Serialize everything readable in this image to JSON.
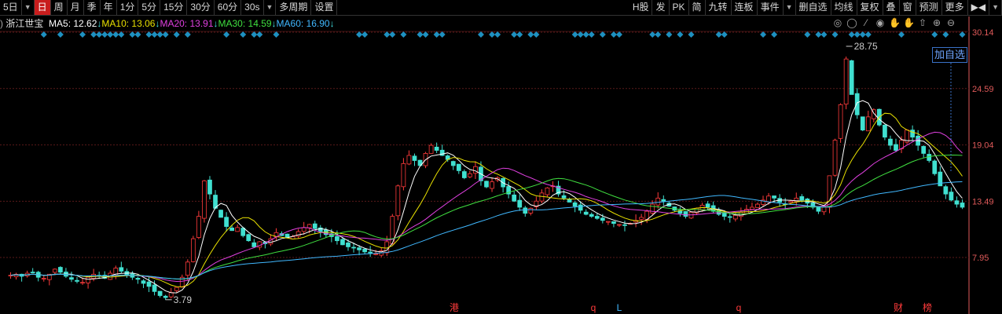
{
  "toolbar": {
    "left": [
      {
        "label": "5日",
        "active": false,
        "caret": true
      },
      {
        "label": "日",
        "active": true
      },
      {
        "label": "周"
      },
      {
        "label": "月"
      },
      {
        "label": "季"
      },
      {
        "label": "年"
      },
      {
        "label": "1分"
      },
      {
        "label": "5分"
      },
      {
        "label": "15分"
      },
      {
        "label": "30分"
      },
      {
        "label": "60分"
      },
      {
        "label": "30s",
        "caret": true
      },
      {
        "label": "多周期"
      },
      {
        "label": "设置"
      }
    ],
    "right": [
      {
        "label": "H股"
      },
      {
        "label": "发"
      },
      {
        "label": "PK"
      },
      {
        "label": "简"
      },
      {
        "label": "九转"
      },
      {
        "label": "连板"
      },
      {
        "label": "事件",
        "caret": true
      },
      {
        "label": "删自选"
      },
      {
        "label": "均线"
      },
      {
        "label": "复权"
      },
      {
        "label": "叠"
      },
      {
        "label": "窗"
      },
      {
        "label": "预测"
      },
      {
        "label": "更多"
      },
      {
        "label": "▶◀",
        "caret": true
      }
    ]
  },
  "ma_line": {
    "stock_name": "浙江世宝",
    "items": [
      {
        "label": "MA5: 12.62",
        "arrow": "↓",
        "color": "#ffffff"
      },
      {
        "label": "MA10: 13.06",
        "arrow": "↓",
        "color": "#e8e000"
      },
      {
        "label": "MA20: 13.91",
        "arrow": "↓",
        "color": "#e040e0"
      },
      {
        "label": "MA30: 14.59",
        "arrow": "↓",
        "color": "#40e040"
      },
      {
        "label": "MA60: 16.90",
        "arrow": "↓",
        "color": "#40b8ff"
      }
    ]
  },
  "tool_icons": [
    "target-icon",
    "circle-icon",
    "brush-icon",
    "eye-icon",
    "hand-icon",
    "hand-icon",
    "up-arrow-icon",
    "zoom-in-icon",
    "zoom-out-icon"
  ],
  "add_favorite": "加自选",
  "colors": {
    "up": "#ff3b3b",
    "down": "#40e0d0",
    "grid": "#5a1a1a",
    "axis": "#e05a5a",
    "marker": "#1e90c0"
  },
  "chart_data": {
    "type": "candlestick",
    "stock": "浙江世宝",
    "y_ticks": [
      30.14,
      24.59,
      19.04,
      13.49,
      7.95
    ],
    "ylim": [
      3.5,
      30.5
    ],
    "annotations": [
      {
        "text": "28.75",
        "label": "high",
        "value": 28.75
      },
      {
        "text": "3.79",
        "label": "low",
        "value": 3.79
      }
    ],
    "event_markers": [
      {
        "text": "港",
        "color": "#ff3b3b"
      },
      {
        "text": "q",
        "color": "#ff3b3b"
      },
      {
        "text": "L",
        "color": "#40b8ff"
      },
      {
        "text": "q",
        "color": "#ff3b3b"
      },
      {
        "text": "财",
        "color": "#ff3b3b"
      },
      {
        "text": "榜",
        "color": "#ff3b3b"
      }
    ],
    "close_path": [
      6.2,
      6.3,
      6.1,
      6.4,
      6.5,
      6.0,
      5.9,
      6.3,
      6.8,
      6.5,
      6.1,
      5.8,
      5.6,
      5.5,
      6.0,
      6.3,
      6.1,
      5.9,
      6.4,
      6.9,
      6.6,
      6.2,
      6.0,
      5.8,
      5.4,
      5.1,
      4.6,
      4.2,
      4.0,
      4.5,
      5.0,
      6.0,
      7.5,
      9.8,
      12.0,
      15.5,
      14.2,
      12.8,
      11.9,
      11.0,
      10.6,
      10.9,
      10.1,
      9.6,
      9.0,
      9.5,
      9.3,
      9.8,
      10.4,
      10.1,
      9.9,
      10.0,
      10.5,
      10.9,
      11.2,
      10.8,
      10.5,
      10.2,
      10.0,
      9.6,
      9.2,
      9.0,
      8.9,
      8.7,
      8.5,
      8.4,
      8.3,
      8.6,
      9.5,
      12.0,
      15.0,
      17.2,
      18.0,
      17.5,
      17.0,
      18.2,
      19.0,
      18.5,
      18.0,
      17.6,
      17.0,
      16.5,
      15.8,
      16.2,
      16.9,
      15.5,
      14.9,
      15.4,
      15.8,
      14.9,
      14.2,
      13.5,
      12.9,
      12.3,
      12.8,
      13.5,
      14.3,
      14.8,
      15.0,
      14.2,
      13.8,
      13.4,
      13.0,
      12.6,
      12.2,
      12.0,
      11.8,
      11.6,
      11.5,
      11.3,
      11.2,
      11.1,
      11.3,
      11.6,
      11.9,
      12.5,
      13.2,
      13.8,
      13.5,
      13.0,
      12.6,
      12.3,
      12.0,
      12.4,
      12.8,
      13.1,
      12.9,
      12.5,
      12.2,
      12.0,
      11.9,
      12.1,
      12.4,
      12.7,
      12.9,
      13.2,
      13.6,
      14.0,
      13.8,
      13.4,
      13.2,
      13.5,
      13.8,
      13.6,
      13.3,
      12.9,
      12.5,
      13.0,
      16.0,
      19.5,
      23.0,
      27.5,
      24.0,
      22.0,
      20.5,
      21.8,
      22.5,
      21.0,
      19.8,
      19.0,
      18.5,
      19.5,
      20.5,
      19.8,
      19.0,
      18.2,
      17.5,
      16.2,
      15.0,
      14.2,
      13.6,
      13.2,
      12.9
    ]
  }
}
